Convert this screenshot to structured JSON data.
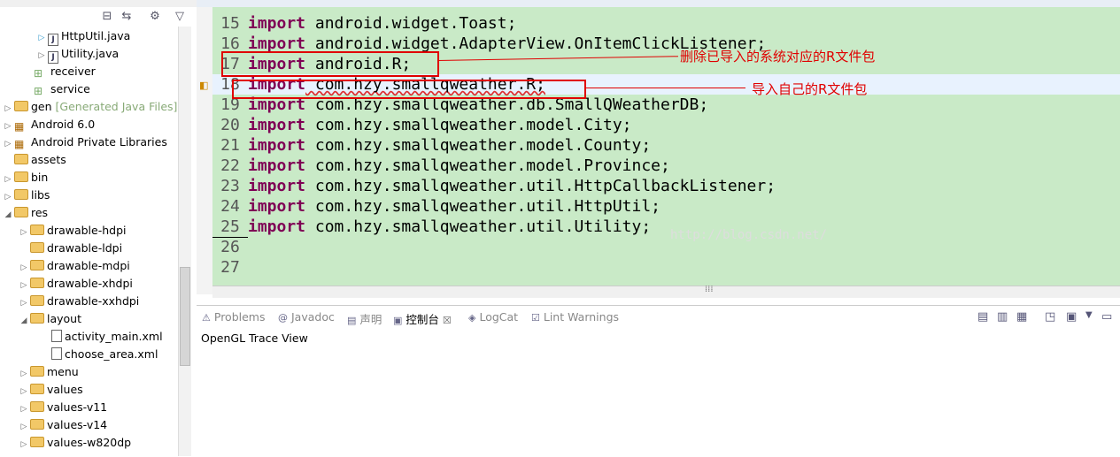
{
  "tree": {
    "items": [
      {
        "label": "HttpUtil.java",
        "hint": ""
      },
      {
        "label": "Utility.java",
        "hint": ""
      },
      {
        "label": "receiver",
        "hint": ""
      },
      {
        "label": "service",
        "hint": ""
      },
      {
        "label": "gen",
        "hint": "[Generated Java Files]"
      },
      {
        "label": "Android 6.0",
        "hint": ""
      },
      {
        "label": "Android Private Libraries",
        "hint": ""
      },
      {
        "label": "assets",
        "hint": ""
      },
      {
        "label": "bin",
        "hint": ""
      },
      {
        "label": "libs",
        "hint": ""
      },
      {
        "label": "res",
        "hint": ""
      },
      {
        "label": "drawable-hdpi",
        "hint": ""
      },
      {
        "label": "drawable-ldpi",
        "hint": ""
      },
      {
        "label": "drawable-mdpi",
        "hint": ""
      },
      {
        "label": "drawable-xhdpi",
        "hint": ""
      },
      {
        "label": "drawable-xxhdpi",
        "hint": ""
      },
      {
        "label": "layout",
        "hint": ""
      },
      {
        "label": "activity_main.xml",
        "hint": ""
      },
      {
        "label": "choose_area.xml",
        "hint": ""
      },
      {
        "label": "menu",
        "hint": ""
      },
      {
        "label": "values",
        "hint": ""
      },
      {
        "label": "values-v11",
        "hint": ""
      },
      {
        "label": "values-v14",
        "hint": ""
      },
      {
        "label": "values-w820dp",
        "hint": ""
      }
    ]
  },
  "editor": {
    "lines": [
      {
        "num": "15",
        "kw": "import",
        "rest": " android.widget.Toast;"
      },
      {
        "num": "16",
        "kw": "import",
        "rest": " android.widget.AdapterView.OnItemClickListener;"
      },
      {
        "num": "17",
        "kw": "import",
        "rest": " android.R;"
      },
      {
        "num": "18",
        "kw": "import",
        "rest": " com.hzy.smallqweather.R;"
      },
      {
        "num": "19",
        "kw": "import",
        "rest": " com.hzy.smallqweather.db.SmallQWeatherDB;"
      },
      {
        "num": "20",
        "kw": "import",
        "rest": " com.hzy.smallqweather.model.City;"
      },
      {
        "num": "21",
        "kw": "import",
        "rest": " com.hzy.smallqweather.model.County;"
      },
      {
        "num": "22",
        "kw": "import",
        "rest": " com.hzy.smallqweather.model.Province;"
      },
      {
        "num": "23",
        "kw": "import",
        "rest": " com.hzy.smallqweather.util.HttpCallbackListener;"
      },
      {
        "num": "24",
        "kw": "import",
        "rest": " com.hzy.smallqweather.util.HttpUtil;"
      },
      {
        "num": "25",
        "kw": "import",
        "rest": " com.hzy.smallqweather.util.Utility;"
      },
      {
        "num": "26",
        "kw": "",
        "rest": ""
      },
      {
        "num": "27",
        "kw": "",
        "rest": ""
      }
    ],
    "annotation_1": "删除已导入的系统对应的R文件包",
    "annotation_2": "导入自己的R文件包",
    "watermark": "http://blog.csdn.net/"
  },
  "bottom": {
    "tabs": [
      {
        "label": "Problems",
        "icon": "⚠"
      },
      {
        "label": "Javadoc",
        "icon": "@"
      },
      {
        "label": "声明",
        "icon": "▤"
      },
      {
        "label": "控制台",
        "icon": "▣"
      },
      {
        "label": "LogCat",
        "icon": "◈"
      },
      {
        "label": "Lint Warnings",
        "icon": "☑"
      }
    ],
    "active_close": "☒",
    "content": "OpenGL Trace View"
  }
}
